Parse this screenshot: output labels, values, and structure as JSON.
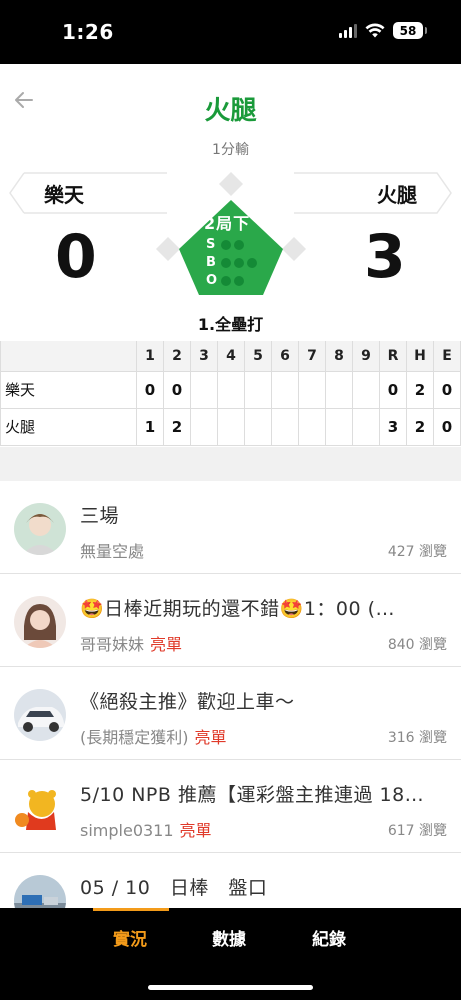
{
  "status": {
    "time": "1:26",
    "battery": "58"
  },
  "header": {
    "title": "火腿",
    "result": "1分輸"
  },
  "game": {
    "away_team": "樂天",
    "home_team": "火腿",
    "away_score": "0",
    "home_score": "3",
    "inning": "2局下",
    "count_labels": [
      "S",
      "B",
      "O"
    ],
    "play": "1.全壘打",
    "colors": {
      "field": "#2aa84a",
      "title": "#1a9a3a"
    }
  },
  "linescore": {
    "headers": [
      "",
      "1",
      "2",
      "3",
      "4",
      "5",
      "6",
      "7",
      "8",
      "9",
      "R",
      "H",
      "E"
    ],
    "rows": [
      [
        "樂天",
        "0",
        "0",
        "",
        "",
        "",
        "",
        "",
        "",
        "",
        "0",
        "2",
        "0"
      ],
      [
        "火腿",
        "1",
        "2",
        "",
        "",
        "",
        "",
        "",
        "",
        "",
        "3",
        "2",
        "0"
      ]
    ]
  },
  "posts": [
    {
      "title": "三場",
      "author": "無量空處",
      "tag": "",
      "views": "427 瀏覽"
    },
    {
      "title": "🤩日棒近期玩的還不錯🤩1：00 (…",
      "author": "哥哥妹妹",
      "tag": "亮單",
      "views": "840 瀏覽"
    },
    {
      "title": "《絕殺主推》歡迎上車～",
      "author": "(長期穩定獲利)",
      "tag": "亮單",
      "views": "316 瀏覽"
    },
    {
      "title": "5/10 NPB 推薦【運彩盤主推連過 18…",
      "author": "simple0311",
      "tag": "亮單",
      "views": "617 瀏覽"
    },
    {
      "title": "05 / 10　日棒　盤口",
      "author": "",
      "tag": "",
      "views": ""
    }
  ],
  "nav": {
    "items": [
      "實況",
      "數據",
      "紀錄"
    ],
    "active": "實況",
    "accent": "#f39b1a"
  }
}
